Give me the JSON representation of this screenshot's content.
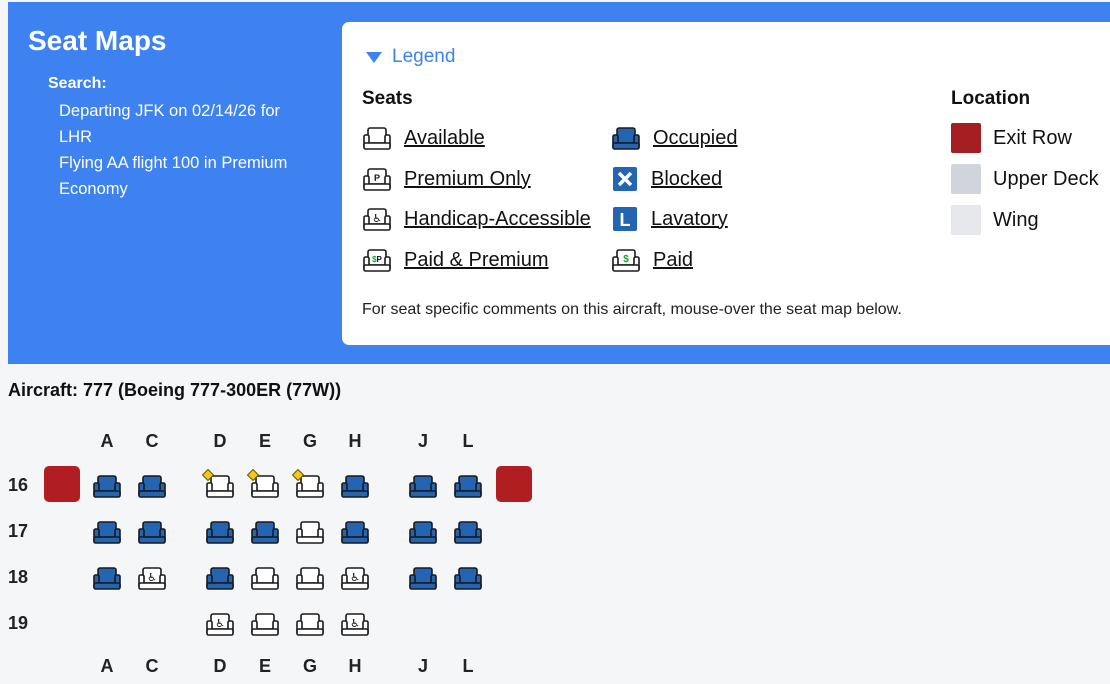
{
  "header": {
    "title": "Seat Maps",
    "search_label": "Search:",
    "search_lines": [
      "Departing JFK on 02/14/26 for LHR",
      "Flying AA flight 100 in Premium Economy"
    ]
  },
  "legend": {
    "toggle_label": "Legend",
    "seats_title": "Seats",
    "location_title": "Location",
    "seat_types": [
      {
        "label": "Available",
        "icon": "seat-available-icon"
      },
      {
        "label": "Premium Only",
        "icon": "seat-premium-icon"
      },
      {
        "label": "Handicap-Accessible",
        "icon": "seat-handicap-icon"
      },
      {
        "label": "Paid & Premium",
        "icon": "seat-paid-premium-icon"
      },
      {
        "label": "Occupied",
        "icon": "seat-occupied-icon"
      },
      {
        "label": "Blocked",
        "icon": "seat-blocked-icon"
      },
      {
        "label": "Lavatory",
        "icon": "lavatory-icon"
      },
      {
        "label": "Paid",
        "icon": "seat-paid-icon"
      }
    ],
    "locations": [
      {
        "label": "Exit Row",
        "color": "#a41e22"
      },
      {
        "label": "Upper Deck",
        "color": "#d2d4db"
      },
      {
        "label": "Wing",
        "color": "#e6e7ea"
      }
    ],
    "note": "For seat specific comments on this aircraft, mouse-over the seat map below."
  },
  "aircraft": "Aircraft: 777 (Boeing 777-300ER (77W))",
  "seat_map": {
    "columns": [
      "A",
      "C",
      "D",
      "E",
      "G",
      "H",
      "J",
      "L"
    ],
    "rows": [
      {
        "number": "16",
        "seats": [
          "occupied",
          "occupied",
          "available-premium",
          "available-premium",
          "available-premium",
          "occupied",
          "occupied",
          "occupied"
        ],
        "exit": true
      },
      {
        "number": "17",
        "seats": [
          "occupied",
          "occupied",
          "occupied",
          "occupied",
          "available",
          "occupied",
          "occupied",
          "occupied"
        ],
        "exit": false
      },
      {
        "number": "18",
        "seats": [
          "occupied",
          "handicap",
          "occupied",
          "available",
          "available",
          "handicap",
          "occupied",
          "occupied"
        ],
        "exit": false
      },
      {
        "number": "19",
        "seats": [
          null,
          null,
          "handicap",
          "available",
          "available",
          "handicap",
          null,
          null
        ],
        "exit": false
      }
    ]
  },
  "colors": {
    "accent": "#3d82f0",
    "occupied": "#2364b3",
    "exit_row": "#b01e22"
  }
}
